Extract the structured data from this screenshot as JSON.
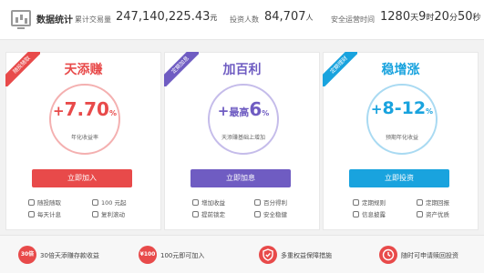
{
  "stats": {
    "title": "数据统计",
    "total_label": "累计交易量",
    "total_value": "247,140,225.43",
    "total_unit": "元",
    "investors_label": "投资人数",
    "investors_value": "84,707",
    "investors_unit": "人",
    "safe_label": "安全运营时间",
    "safe_days": "1280",
    "safe_days_unit": "天",
    "safe_hours": "9",
    "safe_hours_unit": "时",
    "safe_minutes": "20",
    "safe_minutes_unit": "分",
    "safe_seconds": "50",
    "safe_seconds_unit": "秒"
  },
  "products": [
    {
      "ribbon": "随投随取",
      "name": "天添赚",
      "rate_prefix": "+",
      "rate": "7.70",
      "rate_unit": "%",
      "rate_desc": "年化收益率",
      "button": "立即加入",
      "color": "#e84a4a",
      "features": [
        "随投随取",
        "100 元起",
        "每天计息",
        "复利滚动"
      ]
    },
    {
      "ribbon": "定期加息",
      "name": "加百利",
      "rate_prefix": "+",
      "rate_pre": "最高",
      "rate": "6",
      "rate_unit": "%",
      "rate_desc": "天添赚基础上增加",
      "button": "立即加息",
      "color": "#6f5cc2",
      "features": [
        "增加收益",
        "百分得利",
        "提前锁定",
        "安全稳健"
      ]
    },
    {
      "ribbon": "定期理财",
      "name": "稳增涨",
      "rate_prefix": "+",
      "rate": "8-12",
      "rate_unit": "%",
      "rate_desc": "预期年化收益",
      "button": "立即投资",
      "color": "#19a3de",
      "features": [
        "定期规则",
        "定期回报",
        "信息披露",
        "资产优质"
      ]
    }
  ],
  "promos": [
    {
      "icon_text": "30倍",
      "text": "30倍天添赚存款收益",
      "color": "#e84a4a"
    },
    {
      "icon_text": "¥100",
      "text": "100元即可加入",
      "color": "#e84a4a"
    },
    {
      "icon_text": "shield",
      "text": "多重权益保障措施",
      "color": "#e84a4a"
    },
    {
      "icon_text": "clock",
      "text": "随时可申请赎回投资",
      "color": "#e84a4a"
    }
  ]
}
